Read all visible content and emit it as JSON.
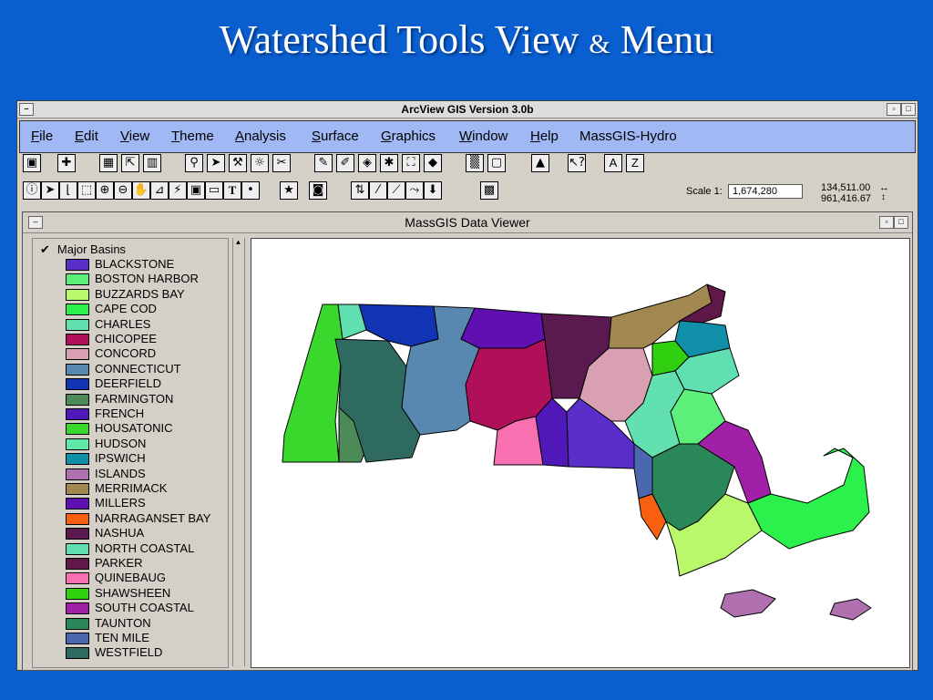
{
  "slide": {
    "title_part1": "Watershed Tools View",
    "title_amp": "&",
    "title_part2": "Menu"
  },
  "app": {
    "title": "ArcView GIS Version 3.0b"
  },
  "menu": [
    "File",
    "Edit",
    "View",
    "Theme",
    "Analysis",
    "Surface",
    "Graphics",
    "Window",
    "Help",
    "MassGIS-Hydro"
  ],
  "menu_mnemonic": [
    "F",
    "E",
    "V",
    "T",
    "A",
    "S",
    "G",
    "W",
    "H",
    ""
  ],
  "toolbar": {
    "text_tool": "T",
    "az_a": "A",
    "az_z": "Z",
    "help_tool": "?"
  },
  "scale": {
    "label": "Scale 1:",
    "value": "1,674,280"
  },
  "coords": {
    "x": "134,511.00",
    "y": "961,416.67"
  },
  "viewer": {
    "title": "MassGIS Data Viewer"
  },
  "legend": {
    "theme": "Major Basins",
    "checked": true,
    "items": [
      {
        "label": "BLACKSTONE",
        "color": "#5a2ec8"
      },
      {
        "label": "BOSTON HARBOR",
        "color": "#5cf07a"
      },
      {
        "label": "BUZZARDS BAY",
        "color": "#b8f86a"
      },
      {
        "label": "CAPE COD",
        "color": "#2cf04c"
      },
      {
        "label": "CHARLES",
        "color": "#62e0b0"
      },
      {
        "label": "CHICOPEE",
        "color": "#b0105a"
      },
      {
        "label": "CONCORD",
        "color": "#d8a0b0"
      },
      {
        "label": "CONNECTICUT",
        "color": "#5888b0"
      },
      {
        "label": "DEERFIELD",
        "color": "#1034b4"
      },
      {
        "label": "FARMINGTON",
        "color": "#4c8a58"
      },
      {
        "label": "FRENCH",
        "color": "#5018b8"
      },
      {
        "label": "HOUSATONIC",
        "color": "#3ad82c"
      },
      {
        "label": "HUDSON",
        "color": "#60e8a8"
      },
      {
        "label": "IPSWICH",
        "color": "#1090a8"
      },
      {
        "label": "ISLANDS",
        "color": "#b070b0"
      },
      {
        "label": "MERRIMACK",
        "color": "#a08850"
      },
      {
        "label": "MILLERS",
        "color": "#6010b0"
      },
      {
        "label": "NARRAGANSET BAY",
        "color": "#f86010"
      },
      {
        "label": "NASHUA",
        "color": "#5a1a50"
      },
      {
        "label": "NORTH COASTAL",
        "color": "#60e0b0"
      },
      {
        "label": "PARKER",
        "color": "#601848"
      },
      {
        "label": "QUINEBAUG",
        "color": "#f870b0"
      },
      {
        "label": "SHAWSHEEN",
        "color": "#30d010"
      },
      {
        "label": "SOUTH COASTAL",
        "color": "#a020a8"
      },
      {
        "label": "TAUNTON",
        "color": "#2a8858"
      },
      {
        "label": "TEN MILE",
        "color": "#4a68b0"
      },
      {
        "label": "WESTFIELD",
        "color": "#2e6a60"
      }
    ]
  }
}
